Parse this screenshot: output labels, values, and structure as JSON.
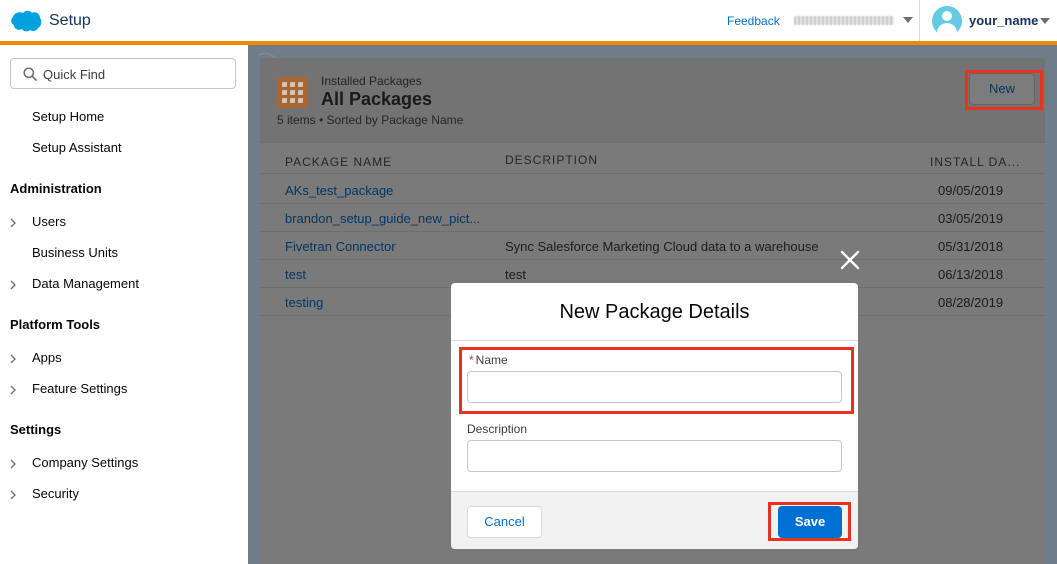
{
  "header": {
    "app_title": "Setup",
    "feedback_label": "Feedback",
    "user_name": "your_name",
    "accent_color": "#ec8a00",
    "icons": [
      "salesforce-cloud-icon",
      "chevron-down-icon",
      "user-avatar-icon"
    ]
  },
  "sidebar": {
    "search_placeholder": "Quick Find",
    "top_links": [
      "Setup Home",
      "Setup Assistant"
    ],
    "sections": [
      {
        "title": "Administration",
        "items": [
          {
            "label": "Users",
            "expandable": true
          },
          {
            "label": "Business Units",
            "expandable": false
          },
          {
            "label": "Data Management",
            "expandable": true
          }
        ]
      },
      {
        "title": "Platform Tools",
        "items": [
          {
            "label": "Apps",
            "expandable": true
          },
          {
            "label": "Feature Settings",
            "expandable": true
          }
        ]
      },
      {
        "title": "Settings",
        "items": [
          {
            "label": "Company Settings",
            "expandable": true
          },
          {
            "label": "Security",
            "expandable": true
          }
        ]
      }
    ]
  },
  "list": {
    "breadcrumb": "Installed Packages",
    "title": "All Packages",
    "meta": "5 items • Sorted by Package Name",
    "new_button": "New",
    "columns": [
      "PACKAGE NAME",
      "DESCRIPTION",
      "INSTALL DA..."
    ],
    "rows": [
      {
        "name": "AKs_test_package",
        "description": "",
        "date": "09/05/2019"
      },
      {
        "name": "brandon_setup_guide_new_pict...",
        "description": "",
        "date": "03/05/2019"
      },
      {
        "name": "Fivetran Connector",
        "description": "Sync Salesforce Marketing Cloud data to a warehouse",
        "date": "05/31/2018"
      },
      {
        "name": "test",
        "description": "test",
        "date": "06/13/2018"
      },
      {
        "name": "testing",
        "description": "",
        "date": "08/28/2019"
      }
    ]
  },
  "modal": {
    "title": "New Package Details",
    "name_required_mark": "*",
    "name_label": "Name",
    "name_value": "",
    "description_label": "Description",
    "description_value": "",
    "cancel_label": "Cancel",
    "save_label": "Save",
    "highlight_color": "#e8321e",
    "brand_color": "#0070d2"
  }
}
